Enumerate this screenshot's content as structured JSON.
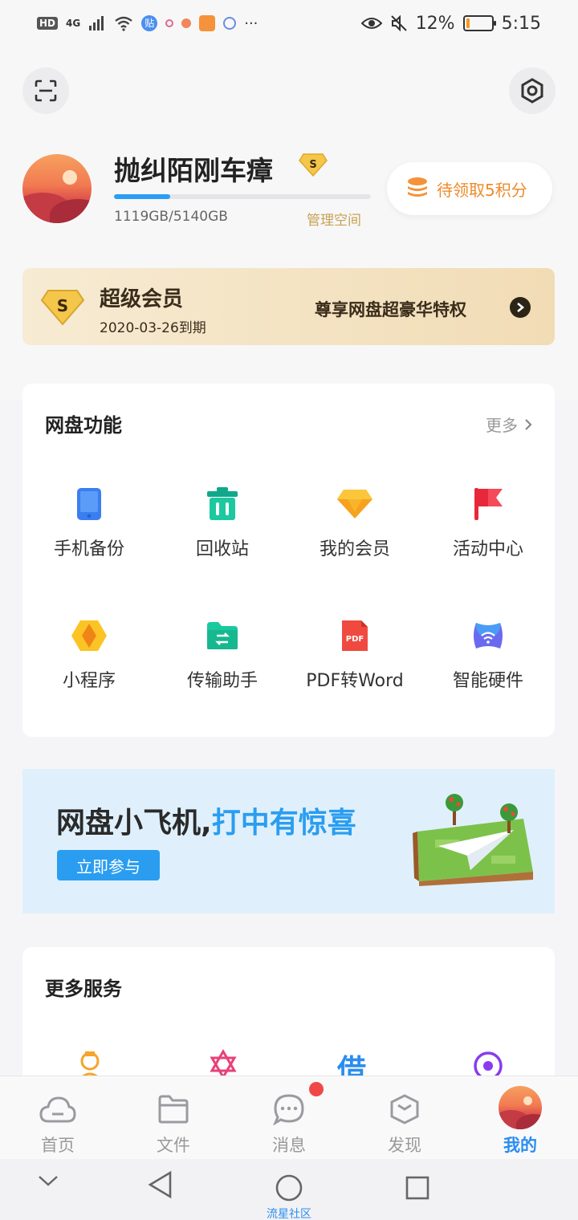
{
  "status_bar": {
    "network": "4G",
    "hd": "HD",
    "app_badge": "贴",
    "more": "···",
    "battery_text": "12%",
    "battery_level": 0.12,
    "time": "5:15"
  },
  "profile": {
    "username": "抛纠陌刚车瘴",
    "badge_letter": "S",
    "storage_used_fraction": 0.218,
    "storage_text": "1119GB/5140GB",
    "manage_label": "管理空间",
    "points_label": "待领取5积分"
  },
  "vip": {
    "badge_letter": "S",
    "title": "超级会员",
    "expiry": "2020-03-26到期",
    "privilege": "尊享网盘超豪华特权"
  },
  "features": {
    "title": "网盘功能",
    "more": "更多",
    "items": [
      {
        "label": "手机备份",
        "icon": "phone-icon"
      },
      {
        "label": "回收站",
        "icon": "trash-icon"
      },
      {
        "label": "我的会员",
        "icon": "diamond-icon"
      },
      {
        "label": "活动中心",
        "icon": "flag-icon"
      },
      {
        "label": "小程序",
        "icon": "hexagon-icon"
      },
      {
        "label": "传输助手",
        "icon": "folder-transfer-icon"
      },
      {
        "label": "PDF转Word",
        "icon": "pdf-icon"
      },
      {
        "label": "智能硬件",
        "icon": "wifi-device-icon"
      }
    ],
    "pdf_tag": "PDF"
  },
  "banner": {
    "title_dark": "网盘小飞机,",
    "title_blue": "打中有惊喜",
    "button": "立即参与"
  },
  "services": {
    "title": "更多服务",
    "borrow_char": "借"
  },
  "tabbar": {
    "items": [
      {
        "label": "首页",
        "icon": "cloud-icon"
      },
      {
        "label": "文件",
        "icon": "folder-icon"
      },
      {
        "label": "消息",
        "icon": "chat-icon"
      },
      {
        "label": "发现",
        "icon": "cube-icon"
      },
      {
        "label": "我的",
        "icon": "avatar"
      }
    ],
    "active": "我的"
  },
  "nav_caption": "流星社区",
  "colors": {
    "accent": "#2a9df0",
    "gold": "#c9a152",
    "points_orange": "#ee8a2a",
    "badge_red": "#f04848"
  }
}
